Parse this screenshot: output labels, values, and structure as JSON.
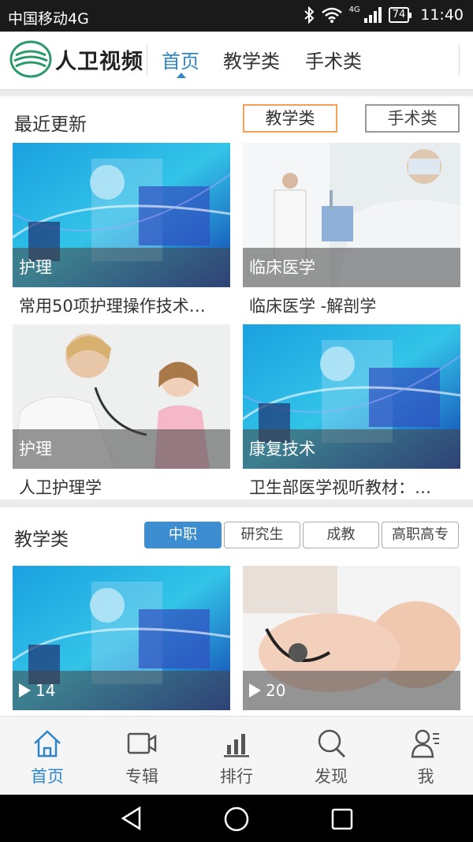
{
  "status_bar": {
    "carrier": "中国移动4G",
    "network": "4G",
    "battery": "74",
    "time": "11:40",
    "icons": [
      "bluetooth-icon",
      "wifi-icon",
      "signal-icon",
      "battery-icon"
    ]
  },
  "header": {
    "logo_text": "人卫视频",
    "nav_tabs": [
      {
        "label": "首页",
        "active": true
      },
      {
        "label": "教学类",
        "active": false
      },
      {
        "label": "手术类",
        "active": false
      }
    ]
  },
  "recent": {
    "title": "最近更新",
    "filters": [
      {
        "label": "教学类",
        "active": true
      },
      {
        "label": "手术类",
        "active": false
      }
    ],
    "cards": [
      {
        "category": "护理",
        "title": "常用50项护理操作技术…"
      },
      {
        "category": "临床医学",
        "title": "临床医学 -解剖学"
      },
      {
        "category": "护理",
        "title": "人卫护理学"
      },
      {
        "category": "康复技术",
        "title": "卫生部医学视听教材：…"
      }
    ]
  },
  "teaching": {
    "title": "教学类",
    "segments": [
      {
        "label": "中职",
        "active": true
      },
      {
        "label": "研究生",
        "active": false
      },
      {
        "label": "成教",
        "active": false
      },
      {
        "label": "高职高专",
        "active": false
      }
    ],
    "cards": [
      {
        "count": "14"
      },
      {
        "count": "20"
      }
    ]
  },
  "tab_bar": [
    {
      "label": "首页",
      "icon": "home-icon",
      "active": true
    },
    {
      "label": "专辑",
      "icon": "video-camera-icon",
      "active": false
    },
    {
      "label": "排行",
      "icon": "bar-chart-icon",
      "active": false
    },
    {
      "label": "发现",
      "icon": "search-icon",
      "active": false
    },
    {
      "label": "我",
      "icon": "user-icon",
      "active": false
    }
  ],
  "colors": {
    "accent": "#2e86c8",
    "filter_active_border": "#f0a05a",
    "segment_active": "#3d8ed0"
  }
}
